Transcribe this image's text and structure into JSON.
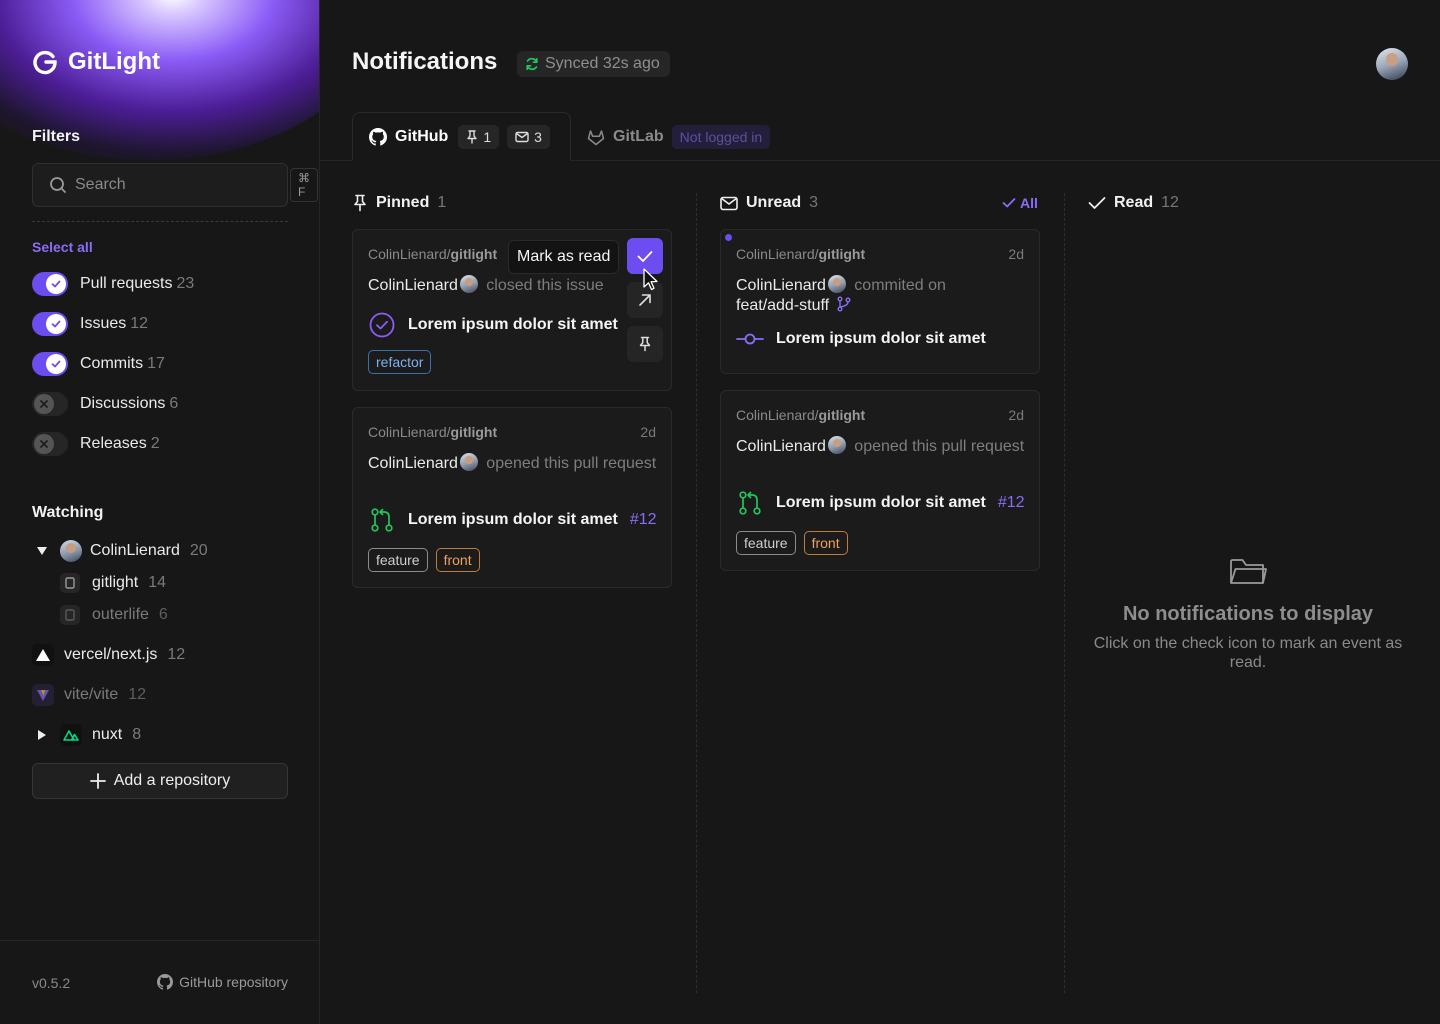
{
  "app": {
    "name": "GitLight",
    "version": "v0.5.2",
    "github_link": "GitHub repository"
  },
  "sidebar": {
    "filters_title": "Filters",
    "search": {
      "placeholder": "Search",
      "shortcut": "⌘ F"
    },
    "select_all": "Select all",
    "filters": [
      {
        "label": "Pull requests",
        "count": "23",
        "enabled": true
      },
      {
        "label": "Issues",
        "count": "12",
        "enabled": true
      },
      {
        "label": "Commits",
        "count": "17",
        "enabled": true
      },
      {
        "label": "Discussions",
        "count": "6",
        "enabled": false
      },
      {
        "label": "Releases",
        "count": "2",
        "enabled": false
      }
    ],
    "watching_title": "Watching",
    "watching": [
      {
        "name": "ColinLienard",
        "count": "20",
        "expanded": true,
        "children": [
          {
            "name": "gitlight",
            "count": "14",
            "muted": false
          },
          {
            "name": "outerlife",
            "count": "6",
            "muted": true
          }
        ]
      },
      {
        "name": "vercel/next.js",
        "count": "12"
      },
      {
        "name": "vite/vite",
        "count": "12",
        "muted": true
      },
      {
        "name": "nuxt",
        "count": "8",
        "expanded": false
      }
    ],
    "add_repository": "Add a repository"
  },
  "header": {
    "title": "Notifications",
    "sync_status": "Synced 32s ago",
    "tabs": [
      {
        "label": "GitHub",
        "pinned": "1",
        "unread": "3",
        "active": true
      },
      {
        "label": "GitLab",
        "status": "Not logged in",
        "active": false
      }
    ]
  },
  "columns": {
    "pinned": {
      "title": "Pinned",
      "count": "1"
    },
    "unread": {
      "title": "Unread",
      "count": "3",
      "mark_all": "All"
    },
    "read": {
      "title": "Read",
      "count": "12",
      "empty_title": "No notifications to display",
      "empty_text": "Click on the check icon to mark an event as read."
    }
  },
  "tooltip": "Mark as read",
  "cards": {
    "pinned": [
      {
        "owner": "ColinLienard/",
        "repo": "gitlight",
        "author": "ColinLienard",
        "action": "closed this issue",
        "subject": "Lorem ipsum dolor sit amet",
        "tags": [
          "refactor"
        ]
      },
      {
        "owner": "ColinLienard/",
        "repo": "gitlight",
        "time": "2d",
        "author": "ColinLienard",
        "action": "opened this pull request",
        "subject": "Lorem ipsum dolor sit amet",
        "number": "#12",
        "tags": [
          "feature",
          "front"
        ]
      }
    ],
    "unread": [
      {
        "owner": "ColinLienard/",
        "repo": "gitlight",
        "time": "2d",
        "author": "ColinLienard",
        "action": "commited on",
        "branch": "feat/add-stuff",
        "subject": "Lorem ipsum dolor sit amet"
      },
      {
        "owner": "ColinLienard/",
        "repo": "gitlight",
        "time": "2d",
        "author": "ColinLienard",
        "action": "opened this pull request",
        "subject": "Lorem ipsum dolor sit amet",
        "number": "#12",
        "tags": [
          "feature",
          "front"
        ]
      }
    ]
  },
  "colors": {
    "accent": "#6d4cf0",
    "accent_text": "#8b6cf7",
    "background": "#171717",
    "card": "#1b1b1b"
  }
}
